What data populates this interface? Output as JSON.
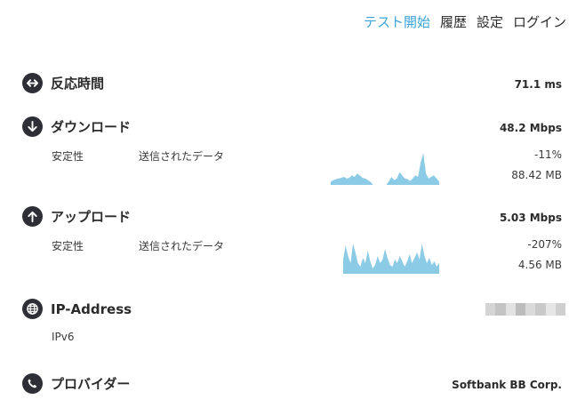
{
  "nav": {
    "start_test": "テスト開始",
    "history": "履歴",
    "settings": "設定",
    "login": "ログイン"
  },
  "latency": {
    "label": "反応時間",
    "value": "71.1 ms",
    "icon": "arrows-horizontal-icon"
  },
  "download": {
    "label": "ダウンロード",
    "value": "48.2 Mbps",
    "icon": "arrow-down-icon",
    "stability_label": "安定性",
    "sent_label": "送信されたデータ",
    "stability_value": "-11%",
    "data_value": "88.42 MB",
    "spark": [
      0.1,
      0.15,
      0.18,
      0.2,
      0.22,
      0.25,
      0.2,
      0.22,
      0.3,
      0.25,
      0.35,
      0.3,
      0.22,
      0.2,
      0.15,
      0.1,
      0,
      0,
      0,
      0,
      0,
      0,
      0.12,
      0.25,
      0.15,
      0.2,
      0.4,
      0.3,
      0.2,
      0.18,
      0.12,
      0.2,
      0.3,
      0.25,
      0.7,
      1.0,
      0.35,
      0.2,
      0.25,
      0.3,
      0.2,
      0.1
    ]
  },
  "upload": {
    "label": "アップロード",
    "value": "5.03 Mbps",
    "icon": "arrow-up-icon",
    "stability_label": "安定性",
    "sent_label": "送信されたデータ",
    "stability_value": "-207%",
    "data_value": "4.56 MB",
    "spark": [
      0.4,
      0.8,
      0.5,
      0.3,
      0.85,
      0.6,
      0.3,
      0.2,
      0.45,
      0.3,
      0.65,
      0.35,
      0.15,
      0.25,
      0.5,
      0.3,
      0.4,
      0.7,
      0.45,
      0.25,
      0.2,
      0.4,
      0.3,
      0.5,
      0.35,
      0.2,
      0.35,
      0.55,
      0.3,
      0.45,
      0.6,
      0.4,
      0.85,
      0.5,
      0.3,
      0.45,
      0.25,
      0.35,
      0.2,
      0.3
    ]
  },
  "ip": {
    "label": "IP-Address",
    "version": "IPv6",
    "icon": "globe-icon"
  },
  "provider": {
    "label": "プロバイダー",
    "value": "Softbank BB Corp.",
    "icon": "phone-icon"
  },
  "colors": {
    "accent": "#3aa4d6",
    "spark_fill": "#8ccbe6",
    "icon_bg": "#2e2e37"
  }
}
